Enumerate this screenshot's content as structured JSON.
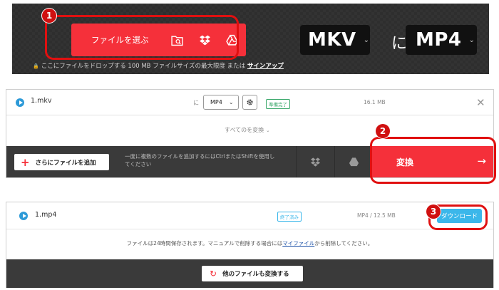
{
  "upload": {
    "step_badge": "1",
    "select_file_label": "ファイルを選ぶ",
    "source_icons": [
      "folder-search-icon",
      "dropbox-icon",
      "google-drive-icon"
    ],
    "from_format": "MKV",
    "connector": "に",
    "to_format": "MP4",
    "drop_hint_lock": "🔒",
    "drop_hint": "ここにファイルをドロップする 100 MB ファイルサイズの最大限度 または ",
    "signup_link": "サインアップ"
  },
  "queue": {
    "file_name": "1.mkv",
    "to_label": "に",
    "format_value": "MP4",
    "status": "準備完了",
    "size": "16.1 MB",
    "convert_all": "すべてのを変換",
    "add_more_label": "さらにファイルを追加",
    "bar_hint": "一度に複数のファイルを追加するにはCtrlまたはShiftを使用してください",
    "convert_label": "変換",
    "step_badge": "2"
  },
  "done": {
    "file_name": "1.mp4",
    "status": "終了済み",
    "info": "MP4 / 12.5 MB",
    "download_label": "ダウンロード",
    "step_badge": "3",
    "retention_prefix": "ファイルは24時間保存されます。マニュアルで削除する場合には",
    "retention_link": "マイファイル",
    "retention_suffix": "から削除してください。",
    "convert_other_label": "他のファイルも変換する"
  },
  "colors": {
    "accent_red": "#f5303a",
    "outline_red": "#e01010",
    "download_blue": "#3bb7ea",
    "dark_panel": "#2e2e2e",
    "status_green": "#3aa86b"
  }
}
